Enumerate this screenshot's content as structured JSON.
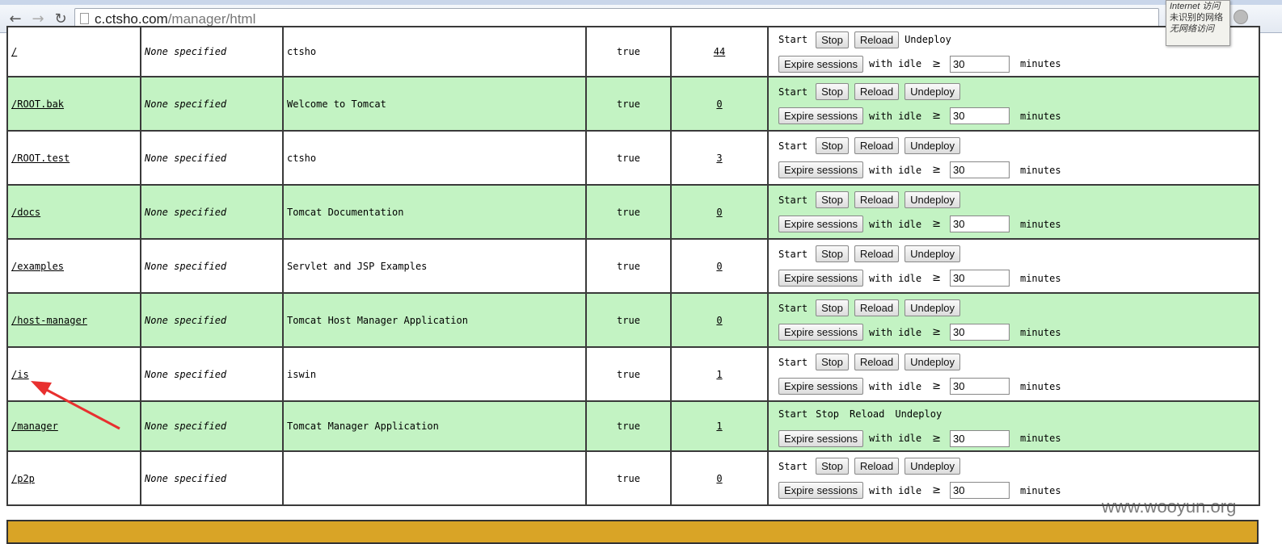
{
  "browser": {
    "address": {
      "host": "c.ctsho.com",
      "path": "/manager/html"
    },
    "popup": {
      "line1": "Internet 访问",
      "line2": "未识别的网络",
      "line3": "无网络访问"
    }
  },
  "labels": {
    "start": "Start",
    "stop": "Stop",
    "reload": "Reload",
    "undeploy": "Undeploy",
    "expire_sessions": "Expire sessions",
    "with_idle": "with idle",
    "ge": "≥",
    "idle_value": "30",
    "minutes": "minutes"
  },
  "applications": [
    {
      "path": "/",
      "version": "None specified",
      "display_name": "ctsho",
      "running": "true",
      "sessions": "44",
      "row_style": "odd",
      "commands_as_text": false,
      "undeploy_as_text": true
    },
    {
      "path": "/ROOT.bak",
      "version": "None specified",
      "display_name": "Welcome to Tomcat",
      "running": "true",
      "sessions": "0",
      "row_style": "even",
      "commands_as_text": false,
      "undeploy_as_text": false
    },
    {
      "path": "/ROOT.test",
      "version": "None specified",
      "display_name": "ctsho",
      "running": "true",
      "sessions": "3",
      "row_style": "odd",
      "commands_as_text": false,
      "undeploy_as_text": false
    },
    {
      "path": "/docs",
      "version": "None specified",
      "display_name": "Tomcat Documentation",
      "running": "true",
      "sessions": "0",
      "row_style": "even",
      "commands_as_text": false,
      "undeploy_as_text": false
    },
    {
      "path": "/examples",
      "version": "None specified",
      "display_name": "Servlet and JSP Examples",
      "running": "true",
      "sessions": "0",
      "row_style": "odd",
      "commands_as_text": false,
      "undeploy_as_text": false
    },
    {
      "path": "/host-manager",
      "version": "None specified",
      "display_name": "Tomcat Host Manager Application",
      "running": "true",
      "sessions": "0",
      "row_style": "even",
      "commands_as_text": false,
      "undeploy_as_text": false
    },
    {
      "path": "/is",
      "version": "None specified",
      "display_name": "iswin",
      "running": "true",
      "sessions": "1",
      "row_style": "odd",
      "commands_as_text": false,
      "undeploy_as_text": false
    },
    {
      "path": "/manager",
      "version": "None specified",
      "display_name": "Tomcat Manager Application",
      "running": "true",
      "sessions": "1",
      "row_style": "even",
      "commands_as_text": true,
      "undeploy_as_text": true
    },
    {
      "path": "/p2p",
      "version": "None specified",
      "display_name": "",
      "running": "true",
      "sessions": "0",
      "row_style": "odd",
      "commands_as_text": false,
      "undeploy_as_text": false
    }
  ],
  "annotation": {
    "arrow_color": "#e8302f"
  },
  "watermark": "www.wooyun.org"
}
